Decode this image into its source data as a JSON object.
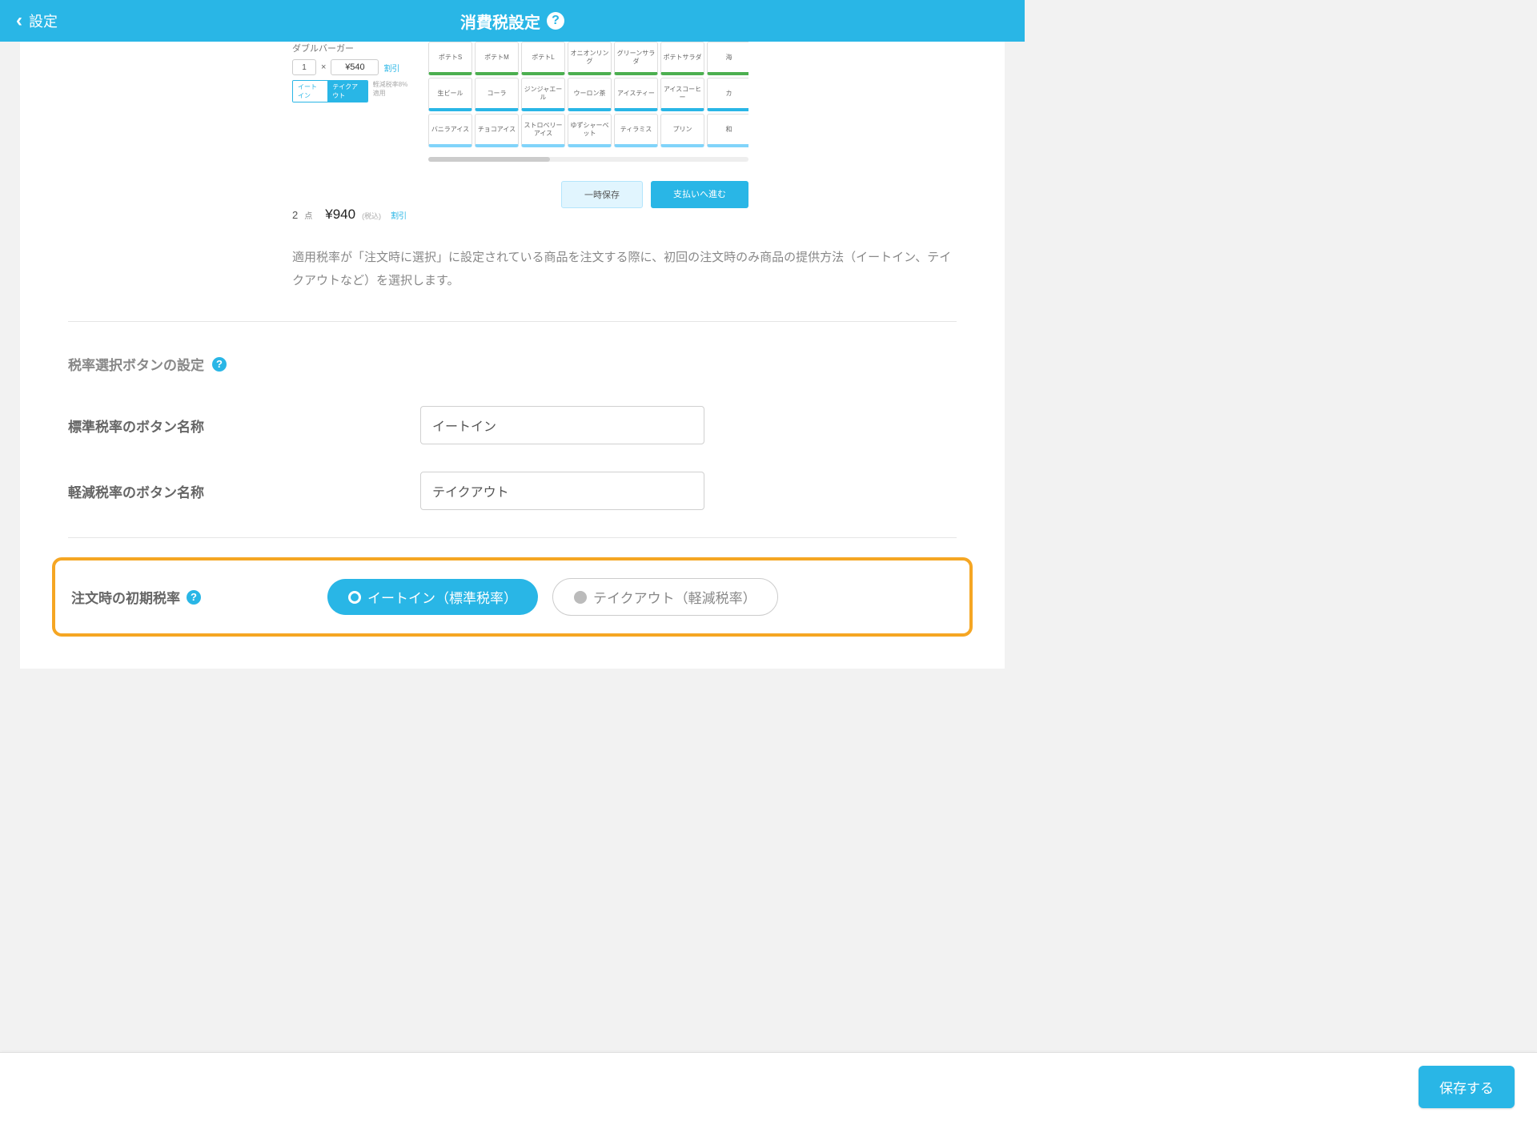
{
  "header": {
    "back_label": "設定",
    "title": "消費税設定"
  },
  "preview": {
    "product_name": "ダブルバーガー",
    "qty": "1",
    "qty_sep": "×",
    "price": "¥540",
    "discount_label": "割引",
    "chip_eat_in": "イートイン",
    "chip_takeout": "テイクアウト",
    "chip_note": "軽減税率8%適用",
    "row1": [
      "ポテトS",
      "ポテトM",
      "ポテトL",
      "オニオンリング",
      "グリーンサラダ",
      "ポテトサラダ",
      "海"
    ],
    "row2": [
      "生ビール",
      "コーラ",
      "ジンジャエール",
      "ウーロン茶",
      "アイスティー",
      "アイスコーヒー",
      "カ"
    ],
    "row3": [
      "バニラアイス",
      "チョコアイス",
      "ストロベリーアイス",
      "ゆずシャーベット",
      "ティラミス",
      "プリン",
      "和"
    ],
    "total_count": "2",
    "total_count_unit": "点",
    "total_price": "¥940",
    "tax_in_label": "(税込)",
    "discount2_label": "割引",
    "temp_save_label": "一時保存",
    "proceed_label": "支払いへ進む"
  },
  "description": "適用税率が「注文時に選択」に設定されている商品を注文する際に、初回の注文時のみ商品の提供方法（イートイン、テイクアウトなど）を選択します。",
  "sections": {
    "button_settings_title": "税率選択ボタンの設定",
    "standard_label": "標準税率のボタン名称",
    "standard_value": "イートイン",
    "reduced_label": "軽減税率のボタン名称",
    "reduced_value": "テイクアウト",
    "initial_rate_label": "注文時の初期税率",
    "radio_eat_in": "イートイン（標準税率）",
    "radio_takeout": "テイクアウト（軽減税率）"
  },
  "footer": {
    "save_label": "保存する"
  }
}
